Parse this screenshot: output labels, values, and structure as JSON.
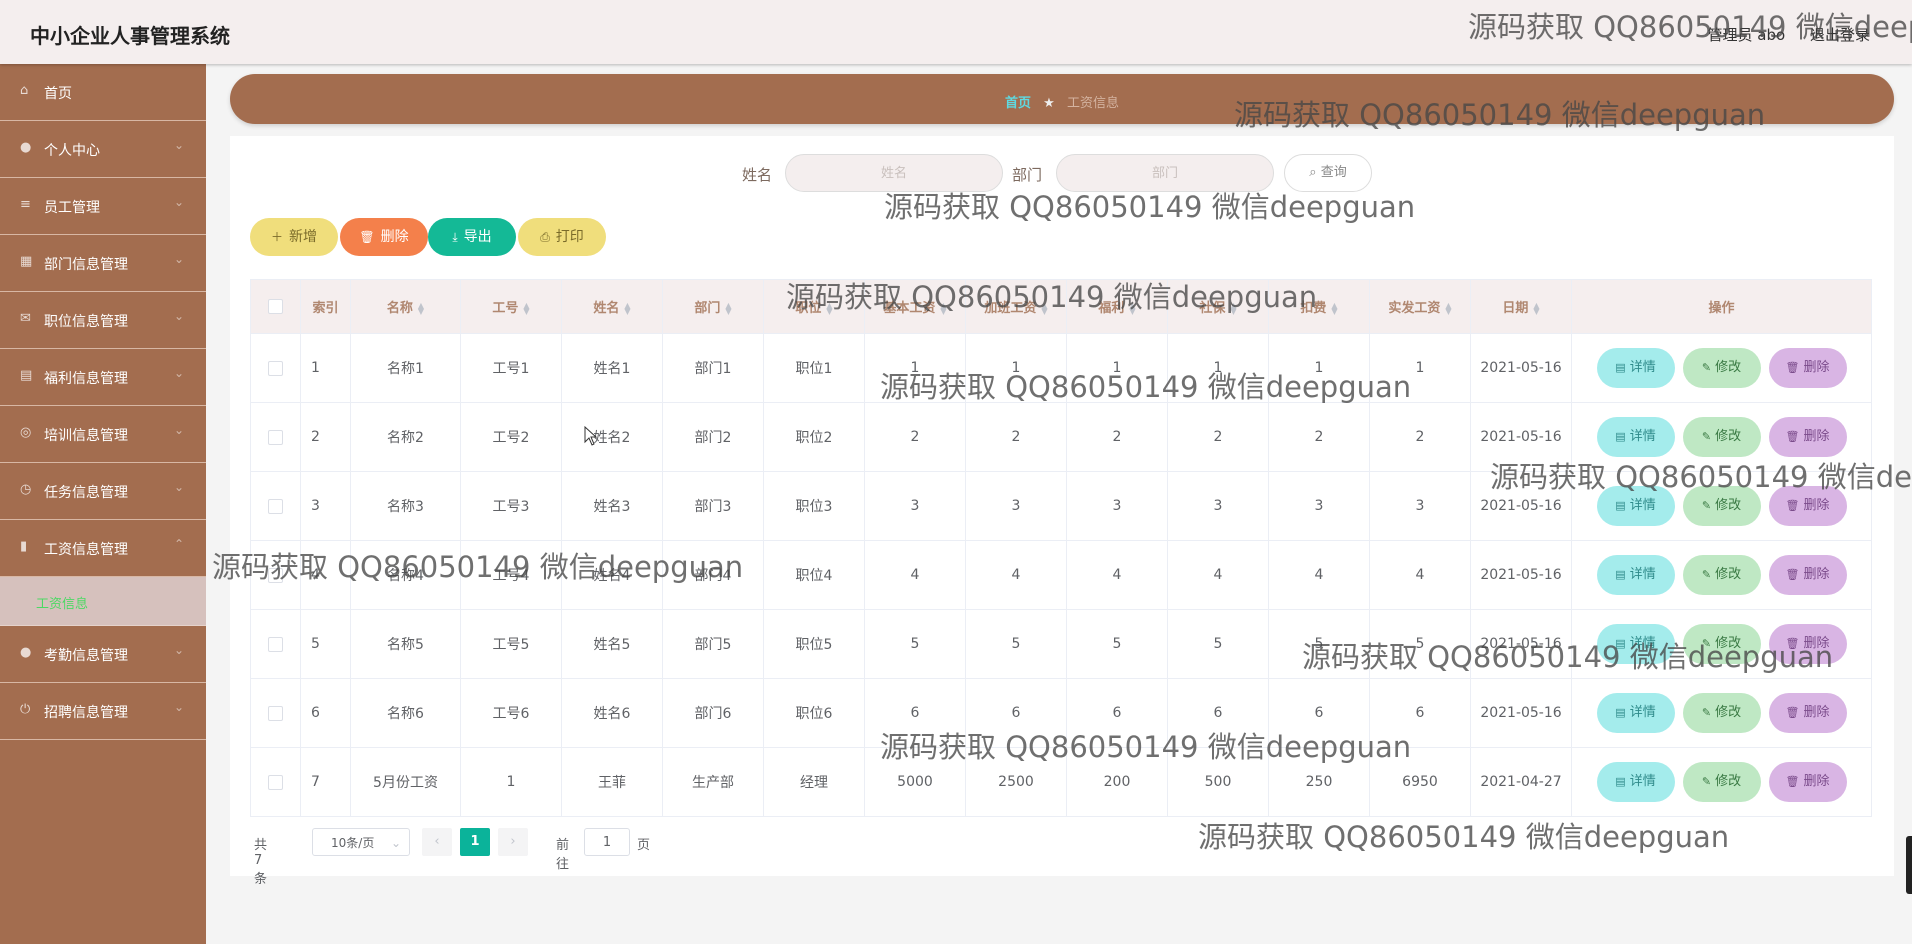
{
  "app": {
    "title": "中小企业人事管理系统"
  },
  "header": {
    "user": "管理员 abo",
    "logout": "退出登录"
  },
  "sidebar": {
    "items": [
      {
        "label": "首页",
        "icon": "home-icon"
      },
      {
        "label": "个人中心",
        "icon": "user-icon"
      },
      {
        "label": "员工管理",
        "icon": "list-icon"
      },
      {
        "label": "部门信息管理",
        "icon": "building-icon"
      },
      {
        "label": "职位信息管理",
        "icon": "mail-icon"
      },
      {
        "label": "福利信息管理",
        "icon": "gift-icon"
      },
      {
        "label": "培训信息管理",
        "icon": "compass-icon"
      },
      {
        "label": "任务信息管理",
        "icon": "clock-icon"
      },
      {
        "label": "工资信息管理",
        "icon": "chart-icon"
      },
      {
        "label": "考勤信息管理",
        "icon": "user-icon"
      },
      {
        "label": "招聘信息管理",
        "icon": "power-icon"
      }
    ],
    "sub_active": "工资信息"
  },
  "breadcrumb": {
    "home": "首页",
    "current": "工资信息"
  },
  "search": {
    "name_label": "姓名",
    "name_placeholder": "姓名",
    "dept_label": "部门",
    "dept_placeholder": "部门",
    "query": "查询"
  },
  "actions": {
    "add": "新增",
    "delete": "删除",
    "export": "导出",
    "print": "打印"
  },
  "colors": {
    "add": "#f0de7c",
    "delete": "#f4804b",
    "export": "#14b996",
    "print": "#f0de7c",
    "accent": "#a36d4f"
  },
  "table": {
    "headers": [
      "索引",
      "名称",
      "工号",
      "姓名",
      "部门",
      "职位",
      "基本工资",
      "加班工资",
      "福利",
      "社保",
      "扣费",
      "实发工资",
      "日期",
      "操作"
    ],
    "rows": [
      [
        "1",
        "名称1",
        "工号1",
        "姓名1",
        "部门1",
        "职位1",
        "1",
        "1",
        "1",
        "1",
        "1",
        "1",
        "2021-05-16"
      ],
      [
        "2",
        "名称2",
        "工号2",
        "姓名2",
        "部门2",
        "职位2",
        "2",
        "2",
        "2",
        "2",
        "2",
        "2",
        "2021-05-16"
      ],
      [
        "3",
        "名称3",
        "工号3",
        "姓名3",
        "部门3",
        "职位3",
        "3",
        "3",
        "3",
        "3",
        "3",
        "3",
        "2021-05-16"
      ],
      [
        "4",
        "名称4",
        "工号4",
        "姓名4",
        "部门4",
        "职位4",
        "4",
        "4",
        "4",
        "4",
        "4",
        "4",
        "2021-05-16"
      ],
      [
        "5",
        "名称5",
        "工号5",
        "姓名5",
        "部门5",
        "职位5",
        "5",
        "5",
        "5",
        "5",
        "5",
        "5",
        "2021-05-16"
      ],
      [
        "6",
        "名称6",
        "工号6",
        "姓名6",
        "部门6",
        "职位6",
        "6",
        "6",
        "6",
        "6",
        "6",
        "6",
        "2021-05-16"
      ],
      [
        "7",
        "5月份工资",
        "1",
        "王菲",
        "生产部",
        "经理",
        "5000",
        "2500",
        "200",
        "500",
        "250",
        "6950",
        "2021-04-27"
      ]
    ],
    "row_actions": {
      "detail": "详情",
      "edit": "修改",
      "delete": "删除"
    }
  },
  "pagination": {
    "total": "共 7 条",
    "page_size": "10条/页",
    "current": "1",
    "goto_prefix": "前往",
    "goto_value": "1",
    "goto_suffix": "页"
  },
  "watermark": "源码获取 QQ86050149 微信deepguan"
}
